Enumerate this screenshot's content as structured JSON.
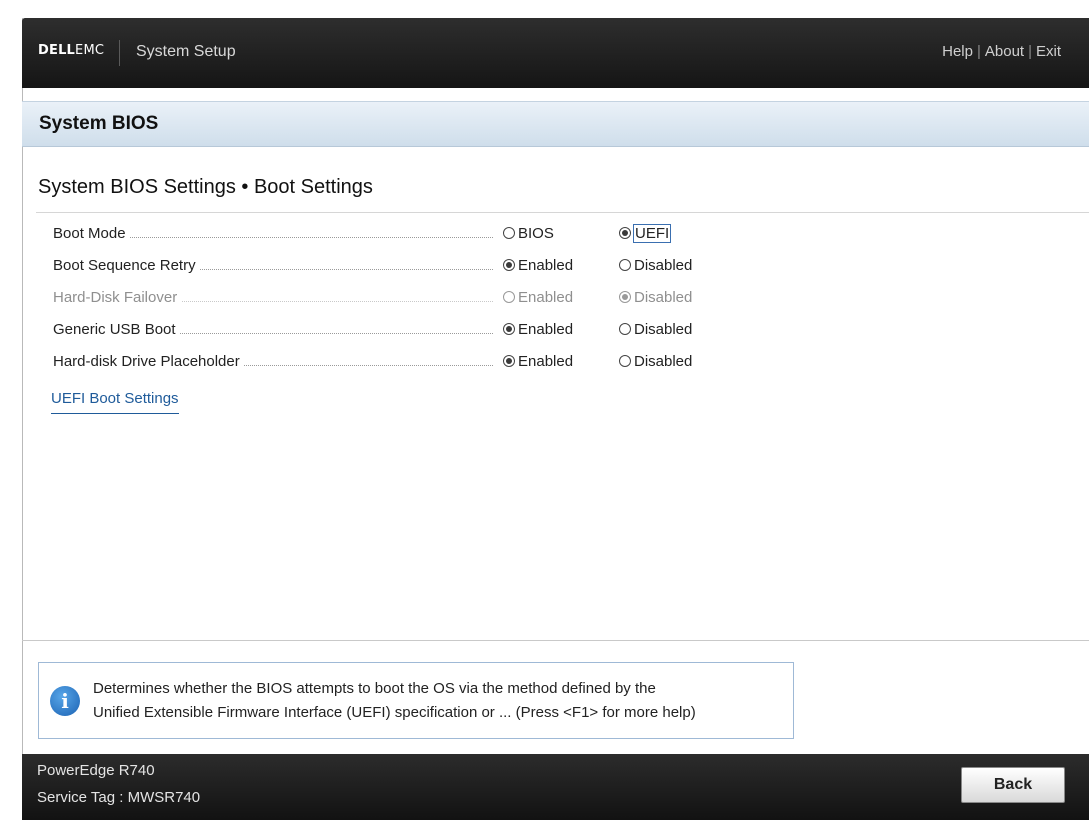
{
  "header": {
    "logo_bold": "DELL",
    "logo_thin": "EMC",
    "title": "System Setup",
    "links": [
      "Help",
      "About",
      "Exit"
    ]
  },
  "section": {
    "title": "System BIOS"
  },
  "page": {
    "heading": "System BIOS Settings • Boot Settings"
  },
  "settings": [
    {
      "label": "Boot Mode",
      "options": [
        "BIOS",
        "UEFI"
      ],
      "selected": "UEFI",
      "disabled": false
    },
    {
      "label": "Boot Sequence Retry",
      "options": [
        "Enabled",
        "Disabled"
      ],
      "selected": "Enabled",
      "disabled": false
    },
    {
      "label": "Hard-Disk Failover",
      "options": [
        "Enabled",
        "Disabled"
      ],
      "selected": "Disabled",
      "disabled": true
    },
    {
      "label": "Generic USB Boot",
      "options": [
        "Enabled",
        "Disabled"
      ],
      "selected": "Enabled",
      "disabled": false
    },
    {
      "label": "Hard-disk Drive Placeholder",
      "options": [
        "Enabled",
        "Disabled"
      ],
      "selected": "Enabled",
      "disabled": false
    }
  ],
  "links": {
    "uefi_boot": "UEFI Boot Settings"
  },
  "help": {
    "icon": "info-icon",
    "line1": "Determines whether the BIOS attempts to boot the OS via the method defined by the",
    "line2": "Unified Extensible Firmware Interface (UEFI) specification or ... (Press <F1> for more help)"
  },
  "footer": {
    "model": "PowerEdge R740",
    "service_tag": "Service Tag : MWSR740",
    "back_label": "Back"
  }
}
